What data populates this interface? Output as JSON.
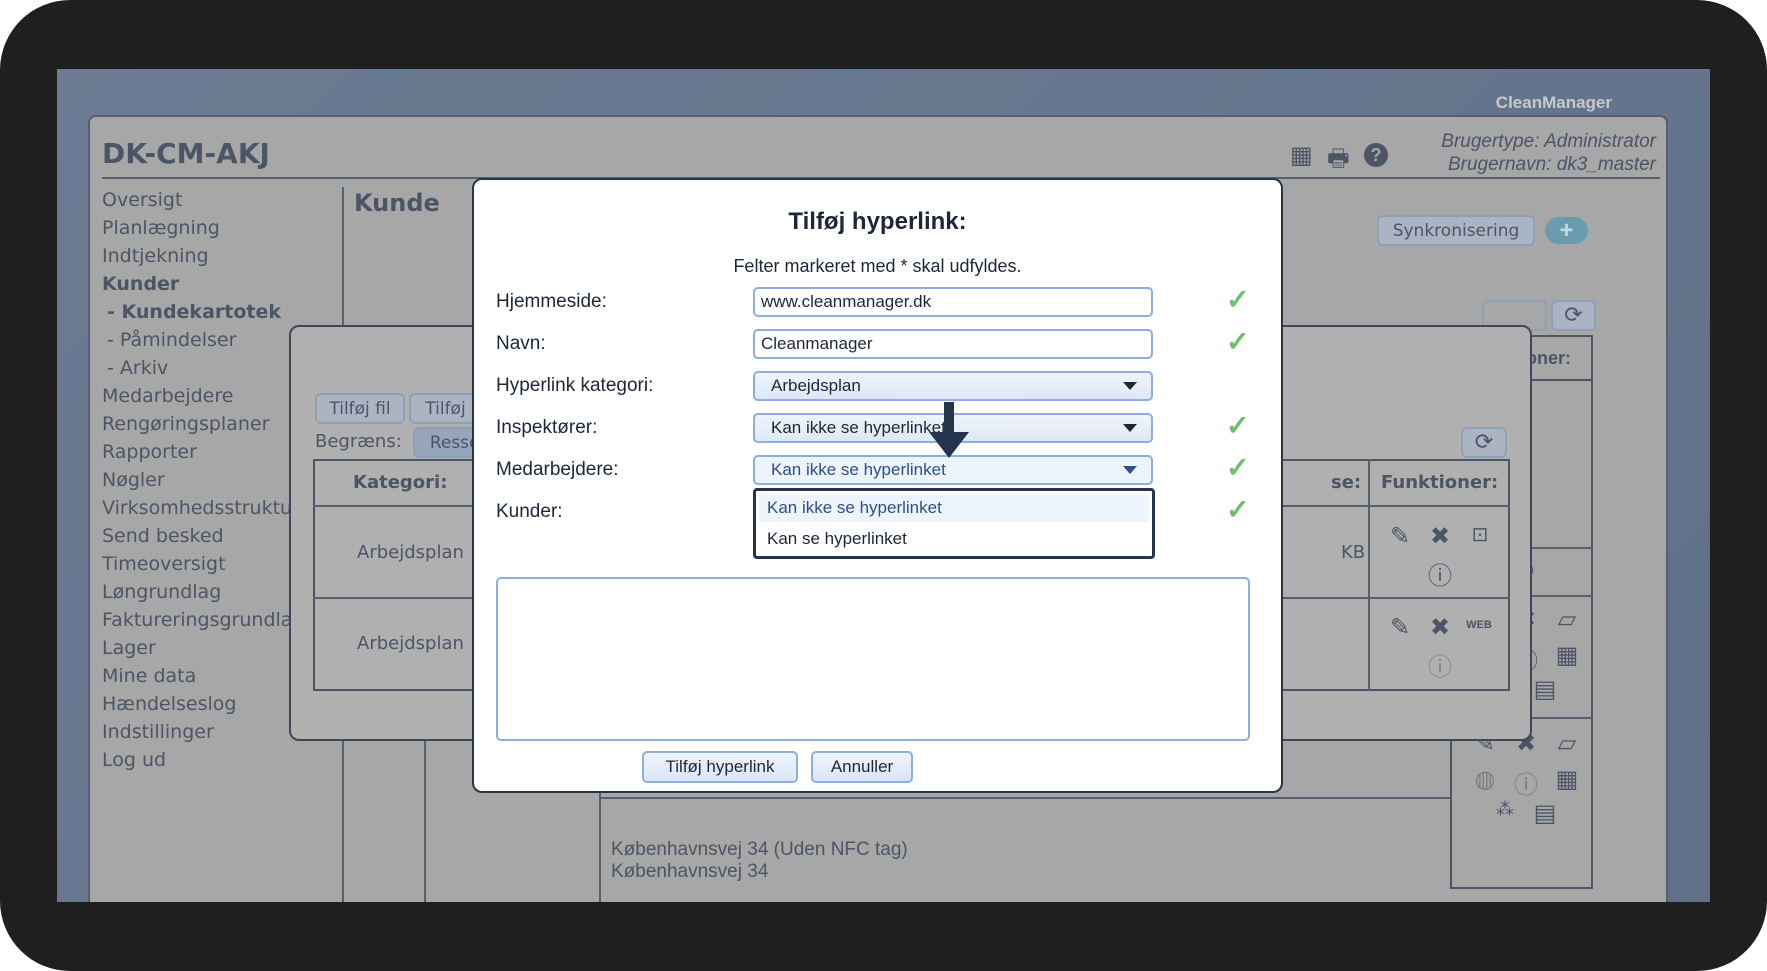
{
  "brand": "CleanManager",
  "header": {
    "site_title": "DK-CM-AKJ",
    "user_type": "Brugertype: Administrator",
    "username": "Brugernavn: dk3_master",
    "icons": [
      "grid-icon",
      "print-icon",
      "help-icon"
    ]
  },
  "sidebar": {
    "items": [
      {
        "label": "Oversigt"
      },
      {
        "label": "Planlægning"
      },
      {
        "label": "Indtjekning"
      },
      {
        "label": "Kunder",
        "active": true
      },
      {
        "label": "- Kundekartotek",
        "active": true
      },
      {
        "label": "- Påmindelser"
      },
      {
        "label": "- Arkiv"
      },
      {
        "label": "Medarbejdere"
      },
      {
        "label": "Rengøringsplaner"
      },
      {
        "label": "Rapporter"
      },
      {
        "label": "Nøgler"
      },
      {
        "label": "Virksomhedsstruktur"
      },
      {
        "label": "Send besked"
      },
      {
        "label": "Timeoversigt"
      },
      {
        "label": "Løngrundlag"
      },
      {
        "label": "Faktureringsgrundlag"
      },
      {
        "label": "Lager"
      },
      {
        "label": "Mine data"
      },
      {
        "label": "Hændelseslog"
      },
      {
        "label": "Indstillinger"
      },
      {
        "label": "Log ud"
      }
    ]
  },
  "main": {
    "title": "Kunde",
    "sync_label": "Synkronisering",
    "functions_header": "Funktioner:",
    "address_lines": [
      "Københavnsvej 34 (Uden NFC tag)",
      "Københavnsvej 34"
    ]
  },
  "files_dialog": {
    "add_file": "Tilføj fil",
    "add_hyperlink": "Tilføj hyp",
    "limit_label": "Begræns:",
    "limit_value": "Ressourc",
    "col_category": "Kategori:",
    "col_size": "se:",
    "col_functions": "Funktioner:",
    "rows": [
      {
        "category": "Arbejdsplan",
        "size": "KB"
      },
      {
        "category": "Arbejdsplan",
        "size": ""
      }
    ]
  },
  "modal": {
    "title": "Tilføj hyperlink:",
    "subtitle": "Felter markeret med * skal udfyldes.",
    "fields": {
      "homepage": {
        "label": "Hjemmeside:",
        "value": "www.cleanmanager.dk"
      },
      "name": {
        "label": "Navn:",
        "value": "Cleanmanager"
      },
      "category": {
        "label": "Hyperlink kategori:",
        "value": "Arbejdsplan"
      },
      "inspectors": {
        "label": "Inspektører:",
        "value": "Kan ikke se hyperlinket"
      },
      "employees": {
        "label": "Medarbejdere:",
        "value": "Kan ikke se hyperlinket"
      },
      "customers": {
        "label": "Kunder:"
      }
    },
    "dropdown_options": [
      "Kan ikke se hyperlinket",
      "Kan se hyperlinket"
    ],
    "submit_label": "Tilføj hyperlink",
    "cancel_label": "Annuller"
  },
  "colors": {
    "valid_check": "#6fbf6a",
    "accent": "#8eaee0",
    "overlay": "#a7a7a7"
  }
}
